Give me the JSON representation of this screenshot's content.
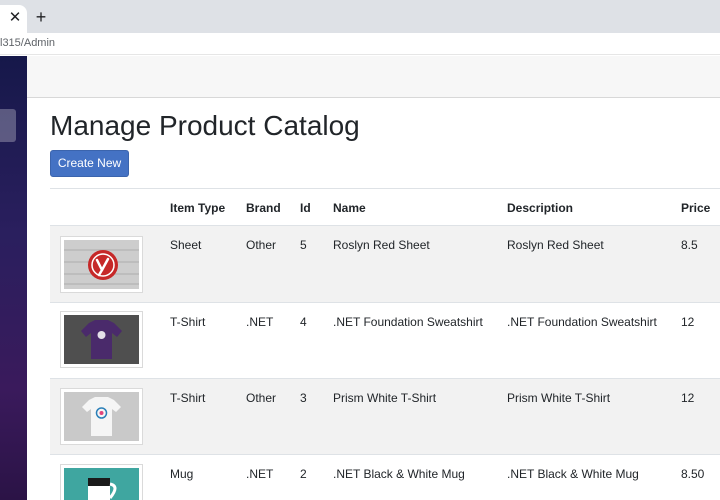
{
  "browser": {
    "tab_close": "✕",
    "new_tab": "+",
    "url": "l315/Admin"
  },
  "page": {
    "title": "Manage Product Catalog",
    "create_label": "Create New"
  },
  "table": {
    "headers": {
      "item_type": "Item Type",
      "brand": "Brand",
      "id": "Id",
      "name": "Name",
      "description": "Description",
      "price": "Price"
    },
    "rows": [
      {
        "item_type": "Sheet",
        "brand": "Other",
        "id": "5",
        "name": "Roslyn Red Sheet",
        "description": "Roslyn Red Sheet",
        "price": "8.5"
      },
      {
        "item_type": "T-Shirt",
        "brand": ".NET",
        "id": "4",
        "name": ".NET Foundation Sweatshirt",
        "description": ".NET Foundation Sweatshirt",
        "price": "12"
      },
      {
        "item_type": "T-Shirt",
        "brand": "Other",
        "id": "3",
        "name": "Prism White T-Shirt",
        "description": "Prism White T-Shirt",
        "price": "12"
      },
      {
        "item_type": "Mug",
        "brand": ".NET",
        "id": "2",
        "name": ".NET Black & White Mug",
        "description": ".NET Black & White Mug",
        "price": "8.50"
      }
    ]
  },
  "colors": {
    "primary_button": "#4472c4",
    "stripe": "#f2f2f2",
    "sidebar_top": "#16184a",
    "sidebar_bottom": "#3a1a5c"
  }
}
